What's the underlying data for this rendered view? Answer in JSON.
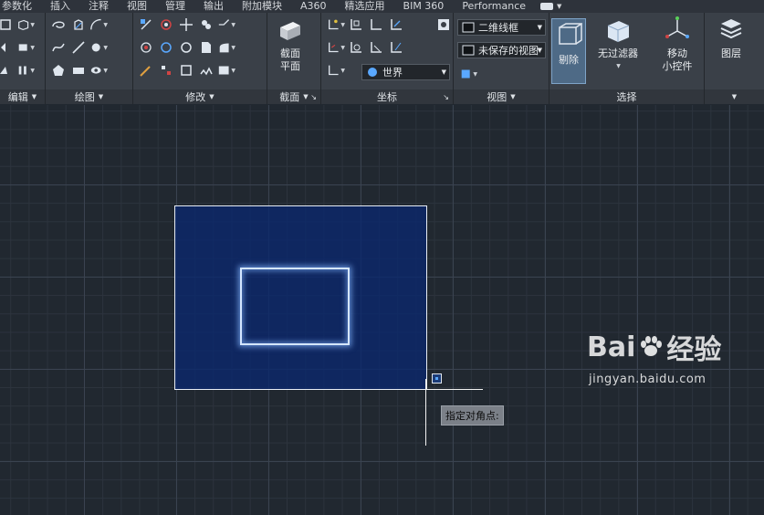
{
  "menubar": {
    "items": [
      "参数化",
      "插入",
      "注释",
      "视图",
      "管理",
      "输出",
      "附加模块",
      "A360",
      "精选应用",
      "BIM 360",
      "Performance"
    ]
  },
  "ribbon": {
    "panels": {
      "modify_edit": {
        "label": "编辑"
      },
      "draw": {
        "label": "绘图"
      },
      "modify": {
        "label": "修改"
      },
      "section": {
        "label": "截面",
        "button_line1": "截面",
        "button_line2": "平面"
      },
      "coordinates": {
        "label": "坐标",
        "ucs_combo_value": "世界"
      },
      "view": {
        "label": "视图",
        "visual_style_value": "二维线框",
        "named_view_value": "未保存的视图"
      },
      "selection": {
        "label": "选择",
        "cull_label": "剔除",
        "no_filter_label": "无过滤器",
        "move_gizmo_line1": "移动",
        "move_gizmo_line2": "小控件"
      },
      "layers": {
        "label": "图层"
      }
    }
  },
  "canvas": {
    "tooltip": "指定对角点:"
  },
  "watermark": {
    "brand_left": "Bai",
    "brand_right": "经验",
    "url": "jingyan.baidu.com"
  },
  "colors": {
    "canvas_bg": "#212830",
    "selection_fill": "#0a286e",
    "highlight_rect": "#d4e6ff",
    "ribbon_bg": "#3a4048"
  }
}
